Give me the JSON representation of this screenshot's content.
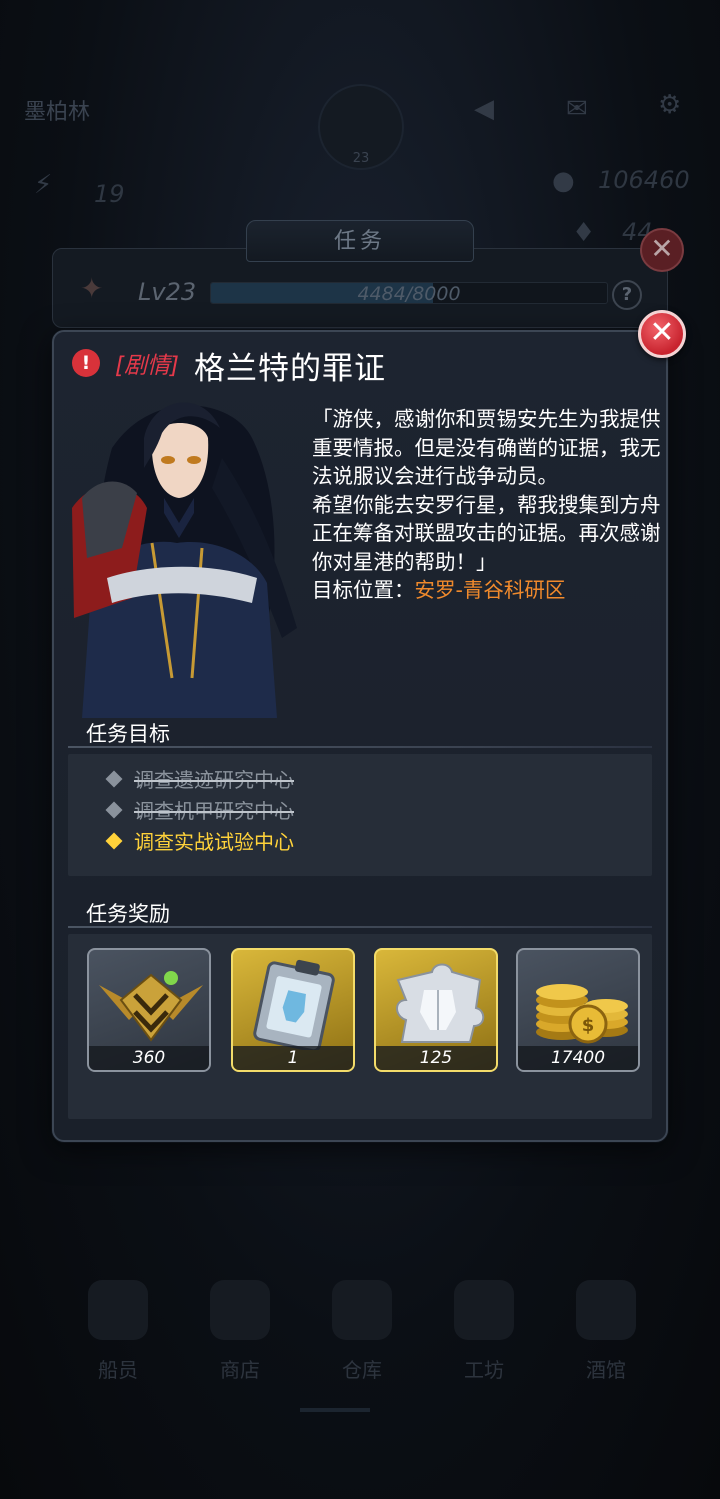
{
  "background": {
    "player_name": "墨柏林",
    "emblem_level": "23",
    "stat_left": "19",
    "stat_coins": "106460",
    "stat_gems": "44",
    "nav": [
      "船员",
      "商店",
      "仓库",
      "工坊",
      "酒馆"
    ]
  },
  "back_panel": {
    "title": "任务",
    "level_label": "Lv23",
    "xp_current": 4484,
    "xp_max": 8000,
    "xp_text": "4484/8000",
    "help_symbol": "?"
  },
  "dialog": {
    "alert_symbol": "!",
    "quest_tag": "[剧情]",
    "quest_title": "格兰特的罪证",
    "quest_text": [
      "「游侠，感谢你和贾锡安先生为我提供重要情报。但是没有确凿的证据，我无法说服议会进行战争动员。",
      "希望你能去安罗行星，帮我搜集到方舟正在筹备对联盟攻击的证据。再次感谢你对星港的帮助！」"
    ],
    "target_label": "目标位置：",
    "target_location": "安罗-青谷科研区",
    "objectives_title": "任务目标",
    "objectives": [
      {
        "text": "调查遗迹研究中心",
        "done": true
      },
      {
        "text": "调查机甲研究中心",
        "done": true
      },
      {
        "text": "调查实战试验中心",
        "done": false
      }
    ],
    "rewards_title": "任务奖励",
    "rewards": [
      {
        "icon": "rank-badge-icon",
        "amount": "360"
      },
      {
        "icon": "blueprint-clipboard-icon",
        "amount": "1"
      },
      {
        "icon": "armor-puzzle-piece-icon",
        "amount": "125"
      },
      {
        "icon": "gold-coins-icon",
        "amount": "17400"
      }
    ],
    "close_symbol": "✕"
  },
  "colors": {
    "tag_red": "#e5394a",
    "location_orange": "#f08a2c",
    "active_yellow": "#ffd23a",
    "close_red": "#d42a35"
  }
}
